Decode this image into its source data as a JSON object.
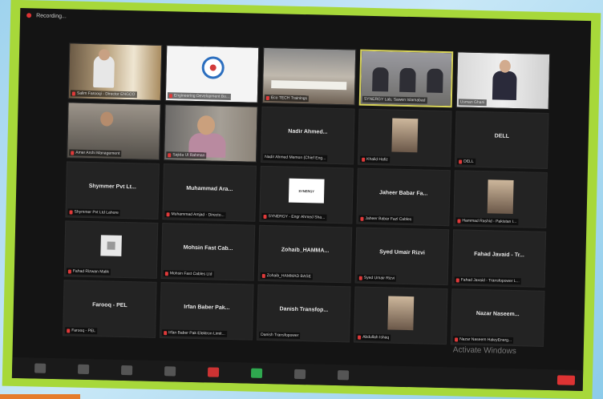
{
  "window": {
    "recording_label": "Recording..."
  },
  "participants": [
    {
      "name": "Salim Farooqi - Director ENGCO",
      "type": "video",
      "muted": true
    },
    {
      "name": "Engineering Development Bo...",
      "type": "logo",
      "muted": true
    },
    {
      "name": "Eco TECH Trainings",
      "type": "video",
      "muted": true
    },
    {
      "name": "SYNERGY Lab, Sawen Islamabad",
      "type": "video",
      "muted": false,
      "active": true
    },
    {
      "name": "Usman Ghani",
      "type": "video",
      "muted": false
    },
    {
      "name": "Amer Arshi Management",
      "type": "video",
      "muted": true
    },
    {
      "name": "Sajida Ul Rahman",
      "type": "video",
      "muted": true
    },
    {
      "display_name": "Nadir Ahmed...",
      "name": "Nadir Ahmed Memon (Chief Eng...",
      "type": "name",
      "muted": false
    },
    {
      "name": "Khalid Hafiz",
      "type": "photo",
      "muted": true
    },
    {
      "display_name": "DELL",
      "name": "DELL",
      "type": "name",
      "muted": true
    },
    {
      "display_name": "Shymmer Pvt Lt...",
      "name": "Shymmer Pvt Ltd Lahore",
      "type": "name",
      "muted": true
    },
    {
      "display_name": "Muhammad Ara...",
      "name": "Muhammad Amjad - Directo...",
      "type": "name",
      "muted": true
    },
    {
      "name": "SYNERGY - Engr Ahmed Sha...",
      "type": "logo_text",
      "logo_text": "SYNERGY",
      "muted": true
    },
    {
      "display_name": "Jaheer Babar Fa...",
      "name": "Jaheer Babar Fazl Cables",
      "type": "name",
      "muted": true
    },
    {
      "name": "Hammad Rashid - Pakistan I...",
      "type": "photo",
      "muted": true
    },
    {
      "name": "Fahad Rizwan Malik",
      "type": "grey_logo",
      "muted": true
    },
    {
      "display_name": "Mohsin Fast Cab...",
      "name": "Mohsin Fast Cables Ltd",
      "type": "name",
      "muted": true
    },
    {
      "display_name": "Zohaib_HAMMA...",
      "name": "Zohaib_HAMMAD BASE",
      "type": "name",
      "muted": true
    },
    {
      "display_name": "Syed Umair Rizvi",
      "name": "Syed Umair Rizvi",
      "type": "name",
      "muted": true
    },
    {
      "display_name": "Fahad Javaid - Tr...",
      "name": "Fahad Javaid - Transfopower L...",
      "type": "name",
      "muted": true
    },
    {
      "display_name": "Farooq - PEL",
      "name": "Farooq - PEL",
      "type": "name",
      "muted": true
    },
    {
      "display_name": "Irfan Baber Pak...",
      "name": "Irfan Baber Pak Elektron Limit...",
      "type": "name",
      "muted": true
    },
    {
      "display_name": "Danish Transfop...",
      "name": "Danish Transfopower",
      "type": "name",
      "muted": false
    },
    {
      "name": "Abdullah Ishaq",
      "type": "photo",
      "muted": true
    },
    {
      "display_name": "Nazar Naseem...",
      "name": "Nazar Naseem HaleyEnerg...",
      "type": "name",
      "muted": true
    }
  ],
  "watermark": "Activate Windows"
}
